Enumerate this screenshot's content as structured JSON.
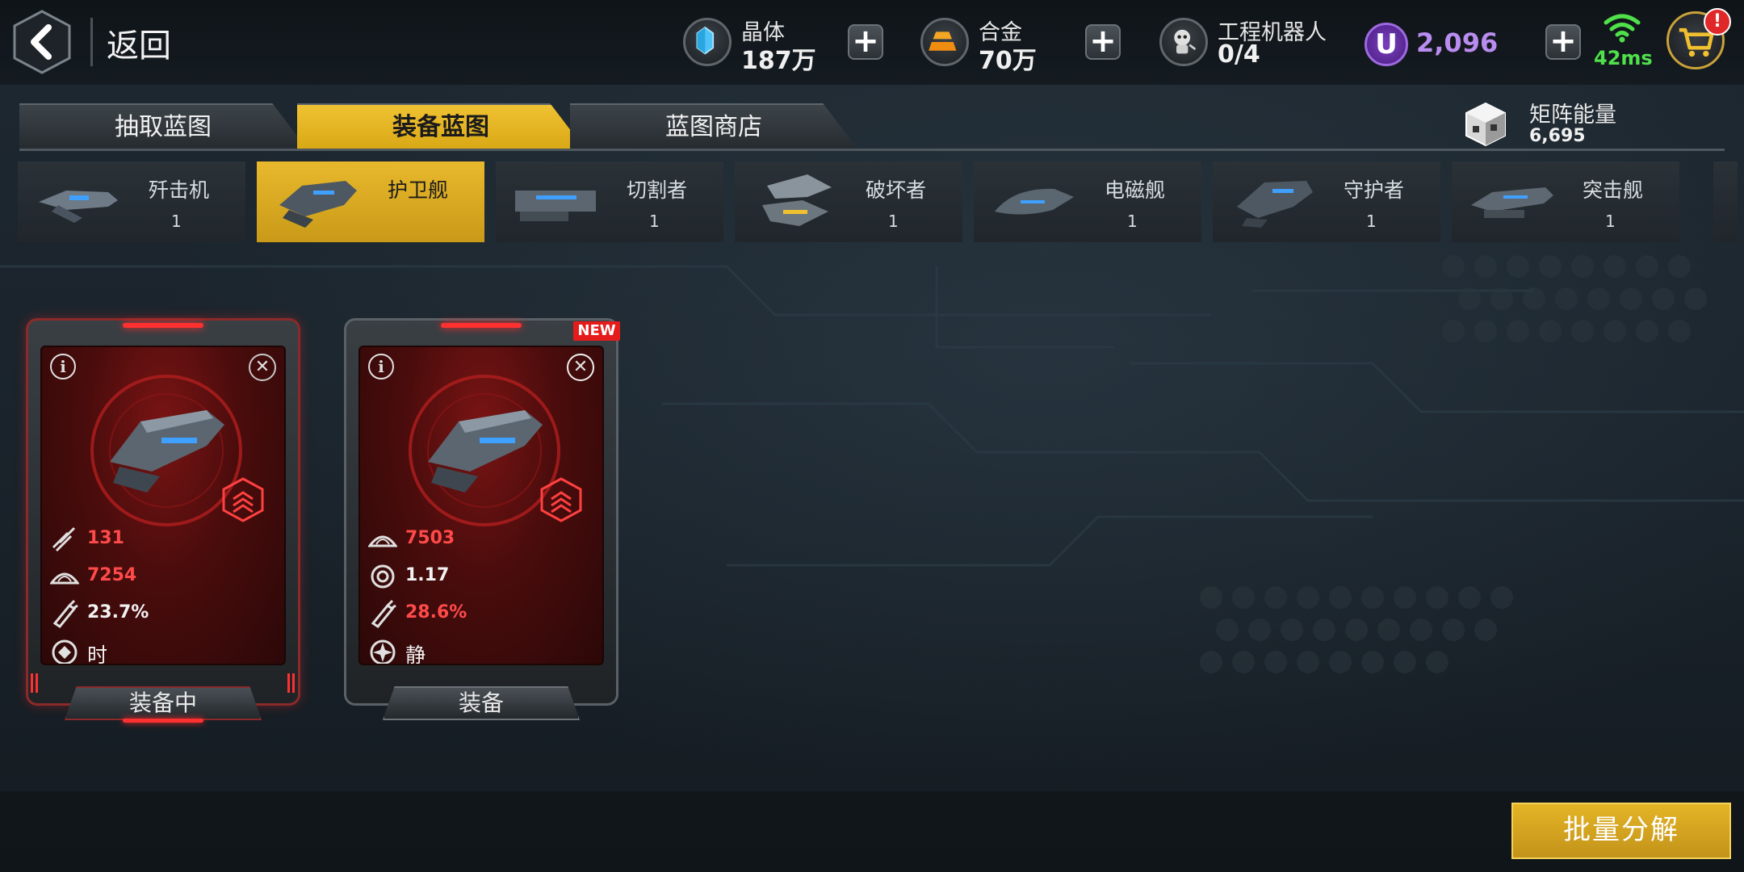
{
  "header": {
    "back_label": "返回",
    "resources": [
      {
        "name": "晶体",
        "value": "187万",
        "icon": "crystal-icon",
        "color": "#4fc3f7"
      },
      {
        "name": "合金",
        "value": "70万",
        "icon": "alloy-icon",
        "color": "#f5a623"
      },
      {
        "name": "工程机器人",
        "value": "0/4",
        "icon": "robot-icon"
      }
    ],
    "premium": {
      "symbol": "U",
      "value": "2,096",
      "color": "#b98cf0"
    },
    "plus": "+",
    "ping": "42ms",
    "cart_badge": "!"
  },
  "tabs": [
    {
      "label": "抽取蓝图",
      "active": false
    },
    {
      "label": "装备蓝图",
      "active": true
    },
    {
      "label": "蓝图商店",
      "active": false
    }
  ],
  "matrix": {
    "label": "矩阵能量",
    "value": "6,695"
  },
  "ships": [
    {
      "name": "歼击机",
      "count": "1",
      "active": false
    },
    {
      "name": "护卫舰",
      "count": "",
      "active": true
    },
    {
      "name": "切割者",
      "count": "1",
      "active": false
    },
    {
      "name": "破坏者",
      "count": "1",
      "active": false
    },
    {
      "name": "电磁舰",
      "count": "1",
      "active": false
    },
    {
      "name": "守护者",
      "count": "1",
      "active": false
    },
    {
      "name": "突击舰",
      "count": "1",
      "active": false
    }
  ],
  "cards": [
    {
      "stats": [
        {
          "icon": "missile-icon",
          "value": "131",
          "color": "red"
        },
        {
          "icon": "shield-icon",
          "value": "7254",
          "color": "red"
        },
        {
          "icon": "thruster-icon",
          "value": "23.7%",
          "color": "white"
        }
      ],
      "skill": {
        "icon": "skill-icon",
        "name": "时光回溯"
      },
      "button": "装备中",
      "new": false
    },
    {
      "stats": [
        {
          "icon": "shield-icon",
          "value": "7503",
          "color": "red"
        },
        {
          "icon": "gear-icon",
          "value": "1.17",
          "color": "white"
        },
        {
          "icon": "thruster-icon",
          "value": "28.6%",
          "color": "red"
        }
      ],
      "skill": {
        "icon": "skill-icon",
        "name": "静电场"
      },
      "button": "装备",
      "new": true,
      "new_label": "NEW"
    }
  ],
  "batch_button": "批量分解"
}
